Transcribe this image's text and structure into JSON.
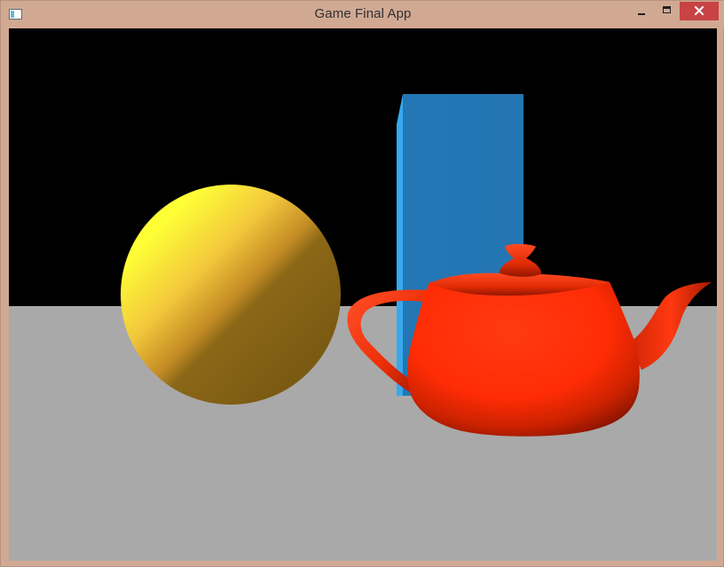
{
  "window": {
    "title": "Game Final App",
    "controls": {
      "minimize": "minimize",
      "maximize": "maximize",
      "close": "close"
    },
    "colors": {
      "frame": "#d1a993",
      "close_button": "#c84343",
      "title_text": "#2f2f2f"
    }
  },
  "scene": {
    "background": "#000000",
    "floor_color": "#a9a9a9",
    "objects": {
      "sphere": "yellow-sphere",
      "box": "blue-box",
      "teapot": "red-teapot"
    },
    "colors": {
      "sphere_light": "#ffff36",
      "sphere_mid": "#e0b334",
      "sphere_dark": "#8b6717",
      "box_front": "#2277b4",
      "box_side": "#37a8ee",
      "teapot_light": "#ff3b14",
      "teapot_dark": "#7a1000"
    }
  }
}
